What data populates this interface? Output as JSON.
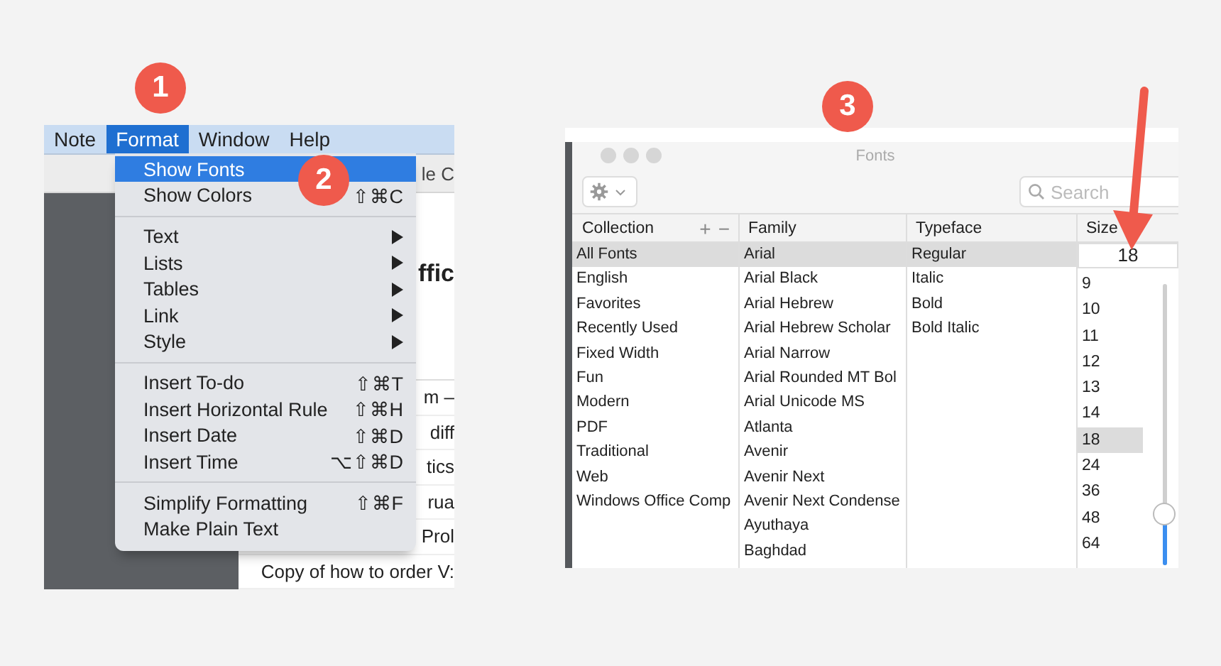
{
  "step_badges": [
    {
      "label": "1"
    },
    {
      "label": "2"
    },
    {
      "label": "3"
    }
  ],
  "notes_app": {
    "menu_bar": [
      {
        "label": "Note",
        "selected": false
      },
      {
        "label": "Format",
        "selected": true
      },
      {
        "label": "Window",
        "selected": false
      },
      {
        "label": "Help",
        "selected": false
      }
    ],
    "toolbar_fragment": "le C",
    "note_title_fragment": "ffic",
    "note_rows": [
      {
        "kind": "partial",
        "text": "m –"
      },
      {
        "kind": "partial",
        "text": "diff"
      },
      {
        "kind": "partial",
        "text": "tics"
      },
      {
        "kind": "partial",
        "text": "rua"
      },
      {
        "kind": "partial",
        "text": "Prol"
      },
      {
        "kind": "full",
        "text": "Copy of how to order V:"
      }
    ],
    "format_menu": [
      {
        "kind": "item",
        "label": "Show Fonts",
        "submenu": false,
        "selected": true
      },
      {
        "kind": "item",
        "label": "Show Colors",
        "shortcut": "⇧⌘C",
        "submenu": false,
        "selected": false
      },
      {
        "kind": "separator"
      },
      {
        "kind": "item",
        "label": "Text",
        "submenu": true,
        "selected": false
      },
      {
        "kind": "item",
        "label": "Lists",
        "submenu": true,
        "selected": false
      },
      {
        "kind": "item",
        "label": "Tables",
        "submenu": true,
        "selected": false
      },
      {
        "kind": "item",
        "label": "Link",
        "submenu": true,
        "selected": false
      },
      {
        "kind": "item",
        "label": "Style",
        "submenu": true,
        "selected": false
      },
      {
        "kind": "separator"
      },
      {
        "kind": "item",
        "label": "Insert To-do",
        "shortcut": "⇧⌘T",
        "submenu": false,
        "selected": false
      },
      {
        "kind": "item",
        "label": "Insert Horizontal Rule",
        "shortcut": "⇧⌘H",
        "submenu": false,
        "selected": false
      },
      {
        "kind": "item",
        "label": "Insert Date",
        "shortcut": "⇧⌘D",
        "submenu": false,
        "selected": false
      },
      {
        "kind": "item",
        "label": "Insert Time",
        "shortcut": "⌥⇧⌘D",
        "submenu": false,
        "selected": false
      },
      {
        "kind": "separator"
      },
      {
        "kind": "item",
        "label": "Simplify Formatting",
        "shortcut": "⇧⌘F",
        "submenu": false,
        "selected": false
      },
      {
        "kind": "item",
        "label": "Make Plain Text",
        "submenu": false,
        "selected": false
      }
    ]
  },
  "fonts_window": {
    "title": "Fonts",
    "search": {
      "placeholder": "Search"
    },
    "columns": [
      "Collection",
      "Family",
      "Typeface",
      "Size"
    ],
    "collection_buttons": [
      "+",
      "−"
    ],
    "collections": [
      {
        "label": "All Fonts",
        "selected": true
      },
      {
        "label": "English",
        "selected": false
      },
      {
        "label": "Favorites",
        "selected": false
      },
      {
        "label": "Recently Used",
        "selected": false
      },
      {
        "label": "Fixed Width",
        "selected": false
      },
      {
        "label": "Fun",
        "selected": false
      },
      {
        "label": "Modern",
        "selected": false
      },
      {
        "label": "PDF",
        "selected": false
      },
      {
        "label": "Traditional",
        "selected": false
      },
      {
        "label": "Web",
        "selected": false
      },
      {
        "label": "Windows Office Comp",
        "selected": false
      }
    ],
    "families": [
      {
        "label": "Arial",
        "selected": true
      },
      {
        "label": "Arial Black",
        "selected": false
      },
      {
        "label": "Arial Hebrew",
        "selected": false
      },
      {
        "label": "Arial Hebrew Scholar",
        "selected": false
      },
      {
        "label": "Arial Narrow",
        "selected": false
      },
      {
        "label": "Arial Rounded MT Bol",
        "selected": false
      },
      {
        "label": "Arial Unicode MS",
        "selected": false
      },
      {
        "label": "Atlanta",
        "selected": false
      },
      {
        "label": "Avenir",
        "selected": false
      },
      {
        "label": "Avenir Next",
        "selected": false
      },
      {
        "label": "Avenir Next Condense",
        "selected": false
      },
      {
        "label": "Ayuthaya",
        "selected": false
      },
      {
        "label": "Baghdad",
        "selected": false
      }
    ],
    "typefaces": [
      {
        "label": "Regular",
        "selected": true
      },
      {
        "label": "Italic",
        "selected": false
      },
      {
        "label": "Bold",
        "selected": false
      },
      {
        "label": "Bold Italic",
        "selected": false
      }
    ],
    "size_value": "18",
    "sizes": [
      {
        "label": "9",
        "selected": false
      },
      {
        "label": "10",
        "selected": false
      },
      {
        "label": "11",
        "selected": false
      },
      {
        "label": "12",
        "selected": false
      },
      {
        "label": "13",
        "selected": false
      },
      {
        "label": "14",
        "selected": false
      },
      {
        "label": "18",
        "selected": true
      },
      {
        "label": "24",
        "selected": false
      },
      {
        "label": "36",
        "selected": false
      },
      {
        "label": "48",
        "selected": false
      },
      {
        "label": "64",
        "selected": false
      }
    ],
    "size_slider": {
      "level": 0.18
    }
  }
}
